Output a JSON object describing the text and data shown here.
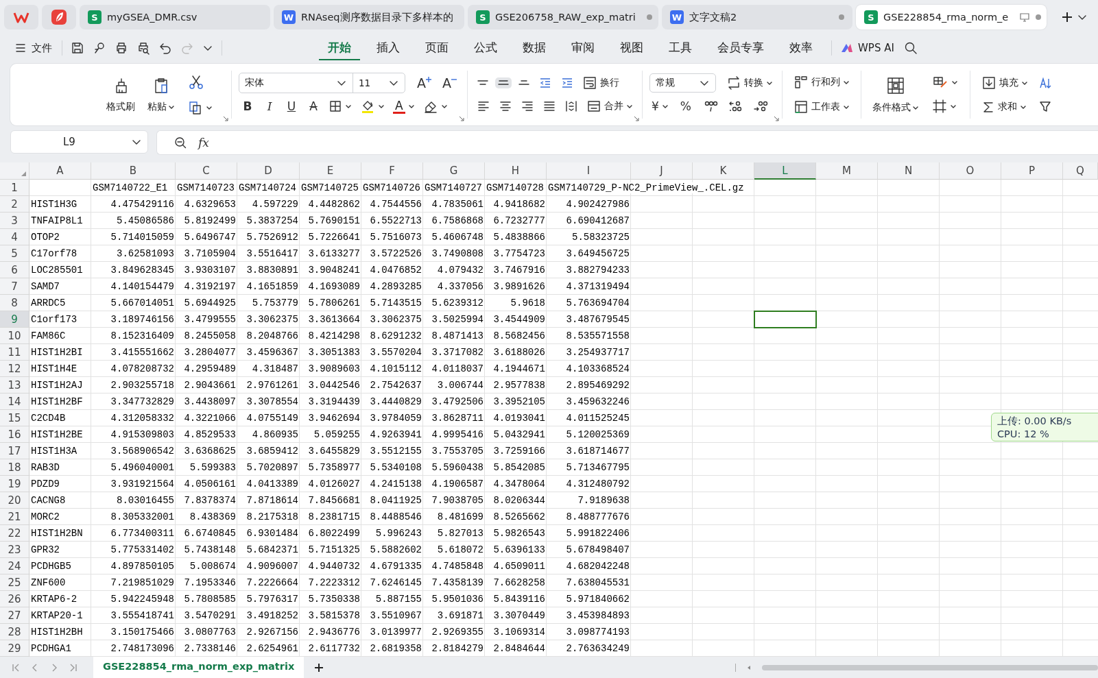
{
  "title_tabs": [
    {
      "kind": "sheet",
      "badge": "S",
      "label": "myGSEA_DMR.csv",
      "selected": false,
      "unsaved": false,
      "monitor": false
    },
    {
      "kind": "writer",
      "badge": "W",
      "label": "RNAseq测序数据目录下多样本的",
      "selected": false,
      "unsaved": false,
      "monitor": false
    },
    {
      "kind": "sheet",
      "badge": "S",
      "label": "GSE206758_RAW_exp_matri",
      "selected": false,
      "unsaved": true,
      "monitor": false
    },
    {
      "kind": "writer",
      "badge": "W",
      "label": "文字文稿2",
      "selected": false,
      "unsaved": true,
      "monitor": false
    },
    {
      "kind": "sheet",
      "badge": "S",
      "label": "GSE228854_rma_norm_e",
      "selected": true,
      "unsaved": true,
      "monitor": true
    }
  ],
  "menu": {
    "file": "文件",
    "quick_access": [
      {
        "kind": "save",
        "disabled": false
      },
      {
        "kind": "loop",
        "disabled": false
      },
      {
        "kind": "print",
        "disabled": false
      },
      {
        "kind": "preview",
        "disabled": false
      },
      {
        "kind": "undo",
        "disabled": false
      },
      {
        "kind": "redo",
        "disabled": true
      },
      {
        "kind": "more",
        "disabled": false
      }
    ],
    "tabs": [
      {
        "label": "开始",
        "selected": true
      },
      {
        "label": "插入",
        "selected": false
      },
      {
        "label": "页面",
        "selected": false
      },
      {
        "label": "公式",
        "selected": false
      },
      {
        "label": "数据",
        "selected": false
      },
      {
        "label": "审阅",
        "selected": false
      },
      {
        "label": "视图",
        "selected": false
      },
      {
        "label": "工具",
        "selected": false
      },
      {
        "label": "会员专享",
        "selected": false
      },
      {
        "label": "效率",
        "selected": false
      }
    ],
    "ai": "WPS AI"
  },
  "ribbon": {
    "format_painter": "格式刷",
    "paste": "粘贴",
    "font": "宋体",
    "font_size": "11",
    "size_buttons": [
      {
        "kind": "grow",
        "label": "A"
      },
      {
        "kind": "shrink",
        "label": "A"
      }
    ],
    "style_buttons": [
      {
        "kind": "bold",
        "label": "B"
      },
      {
        "kind": "italic",
        "label": "I"
      },
      {
        "kind": "underline",
        "label": "U"
      },
      {
        "kind": "strike",
        "label": "A"
      }
    ],
    "font_color": "A",
    "valign": [
      {
        "selected": false
      },
      {
        "selected": true
      },
      {
        "selected": false
      }
    ],
    "wrap": "换行",
    "merge": "合并",
    "number_format": "常规",
    "convert": "转换",
    "currency": "¥",
    "percent": "%",
    "rows_cols": "行和列",
    "worksheet": "工作表",
    "cond_format": "条件格式",
    "fill": "填充",
    "sum": "求和"
  },
  "formula_bar": {
    "name_box": "L9",
    "function_label": "fx"
  },
  "sheet": {
    "columns": [
      {
        "label": "A",
        "selected": false
      },
      {
        "label": "B",
        "selected": false
      },
      {
        "label": "C",
        "selected": false
      },
      {
        "label": "D",
        "selected": false
      },
      {
        "label": "E",
        "selected": false
      },
      {
        "label": "F",
        "selected": false
      },
      {
        "label": "G",
        "selected": false
      },
      {
        "label": "H",
        "selected": false
      },
      {
        "label": "I",
        "selected": false
      },
      {
        "label": "J",
        "selected": false
      },
      {
        "label": "K",
        "selected": false
      },
      {
        "label": "L",
        "selected": true
      },
      {
        "label": "M",
        "selected": false
      },
      {
        "label": "N",
        "selected": false
      },
      {
        "label": "O",
        "selected": false
      },
      {
        "label": "P",
        "selected": false
      },
      {
        "label": "Q",
        "selected": false
      }
    ],
    "header_row": {
      "number": "1",
      "selected": false,
      "cells": [
        "GSM7140722_E1",
        "GSM7140723",
        "GSM7140724",
        "GSM7140725",
        "GSM7140726",
        "GSM7140727",
        "GSM7140728",
        "GSM7140729_P-NC2_PrimeView_.CEL.gz"
      ]
    },
    "rows": [
      {
        "number": "2",
        "selected": false,
        "cells": [
          "HIST1H3G",
          "4.475429116",
          "4.6329653",
          "4.597229",
          "4.4482862",
          "4.7544556",
          "4.7835061",
          "4.9418682",
          "4.902427986"
        ]
      },
      {
        "number": "3",
        "selected": false,
        "cells": [
          "TNFAIP8L1",
          "5.45086586",
          "5.8192499",
          "5.3837254",
          "5.7690151",
          "6.5522713",
          "6.7586868",
          "6.7232777",
          "6.690412687"
        ]
      },
      {
        "number": "4",
        "selected": false,
        "cells": [
          "OTOP2",
          "5.714015059",
          "5.6496747",
          "5.7526912",
          "5.7226641",
          "5.7516073",
          "5.4606748",
          "5.4838866",
          "5.58323725"
        ]
      },
      {
        "number": "5",
        "selected": false,
        "cells": [
          "C17orf78",
          "3.62581093",
          "3.7105904",
          "3.5516417",
          "3.6133277",
          "3.5722526",
          "3.7490808",
          "3.7754723",
          "3.649456725"
        ]
      },
      {
        "number": "6",
        "selected": false,
        "cells": [
          "LOC285501",
          "3.849628345",
          "3.9303107",
          "3.8830891",
          "3.9048241",
          "4.0476852",
          "4.079432",
          "3.7467916",
          "3.882794233"
        ]
      },
      {
        "number": "7",
        "selected": false,
        "cells": [
          "SAMD7",
          "4.140154479",
          "4.3192197",
          "4.1651859",
          "4.1693089",
          "4.2893285",
          "4.337056",
          "3.9891626",
          "4.371319494"
        ]
      },
      {
        "number": "8",
        "selected": false,
        "cells": [
          "ARRDC5",
          "5.667014051",
          "5.6944925",
          "5.753779",
          "5.7806261",
          "5.7143515",
          "5.6239312",
          "5.9618",
          "5.763694704"
        ]
      },
      {
        "number": "9",
        "selected": true,
        "cells": [
          "C1orf173",
          "3.189746156",
          "3.4799555",
          "3.3062375",
          "3.3613664",
          "3.3062375",
          "3.5025994",
          "3.4544909",
          "3.487679545"
        ]
      },
      {
        "number": "10",
        "selected": false,
        "cells": [
          "FAM86C",
          "8.152316409",
          "8.2455058",
          "8.2048766",
          "8.4214298",
          "8.6291232",
          "8.4871413",
          "8.5682456",
          "8.535571558"
        ]
      },
      {
        "number": "11",
        "selected": false,
        "cells": [
          "HIST1H2BI",
          "3.415551662",
          "3.2804077",
          "3.4596367",
          "3.3051383",
          "3.5570204",
          "3.3717082",
          "3.6188026",
          "3.254937717"
        ]
      },
      {
        "number": "12",
        "selected": false,
        "cells": [
          "HIST1H4E",
          "4.078208732",
          "4.2959489",
          "4.318487",
          "3.9089603",
          "4.1015112",
          "4.0118037",
          "4.1944671",
          "4.103368524"
        ]
      },
      {
        "number": "13",
        "selected": false,
        "cells": [
          "HIST1H2AJ",
          "2.903255718",
          "2.9043661",
          "2.9761261",
          "3.0442546",
          "2.7542637",
          "3.006744",
          "2.9577838",
          "2.895469292"
        ]
      },
      {
        "number": "14",
        "selected": false,
        "cells": [
          "HIST1H2BF",
          "3.347732829",
          "3.4438097",
          "3.3078554",
          "3.3194439",
          "3.4440829",
          "3.4792506",
          "3.3952105",
          "3.459632246"
        ]
      },
      {
        "number": "15",
        "selected": false,
        "cells": [
          "C2CD4B",
          "4.312058332",
          "4.3221066",
          "4.0755149",
          "3.9462694",
          "3.9784059",
          "3.8628711",
          "4.0193041",
          "4.011525245"
        ]
      },
      {
        "number": "16",
        "selected": false,
        "cells": [
          "HIST1H2BE",
          "4.915309803",
          "4.8529533",
          "4.860935",
          "5.059255",
          "4.9263941",
          "4.9995416",
          "5.0432941",
          "5.120025369"
        ]
      },
      {
        "number": "17",
        "selected": false,
        "cells": [
          "HIST1H3A",
          "3.568906542",
          "3.6368625",
          "3.6859412",
          "3.6455829",
          "3.5512155",
          "3.7553705",
          "3.7259166",
          "3.618714677"
        ]
      },
      {
        "number": "18",
        "selected": false,
        "cells": [
          "RAB3D",
          "5.496040001",
          "5.599383",
          "5.7020897",
          "5.7358977",
          "5.5340108",
          "5.5960438",
          "5.8542085",
          "5.713467795"
        ]
      },
      {
        "number": "19",
        "selected": false,
        "cells": [
          "PDZD9",
          "3.931921564",
          "4.0506161",
          "4.0413389",
          "4.0126027",
          "4.2415138",
          "4.1906587",
          "4.3478064",
          "4.312480792"
        ]
      },
      {
        "number": "20",
        "selected": false,
        "cells": [
          "CACNG8",
          "8.03016455",
          "7.8378374",
          "7.8718614",
          "7.8456681",
          "8.0411925",
          "7.9038705",
          "8.0206344",
          "7.9189638"
        ]
      },
      {
        "number": "21",
        "selected": false,
        "cells": [
          "MORC2",
          "8.305332001",
          "8.438369",
          "8.2175318",
          "8.2381715",
          "8.4488546",
          "8.481699",
          "8.5265662",
          "8.488777676"
        ]
      },
      {
        "number": "22",
        "selected": false,
        "cells": [
          "HIST1H2BN",
          "6.773400311",
          "6.6740845",
          "6.9301484",
          "6.8022499",
          "5.996243",
          "5.827013",
          "5.9826543",
          "5.991822406"
        ]
      },
      {
        "number": "23",
        "selected": false,
        "cells": [
          "GPR32",
          "5.775331402",
          "5.7438148",
          "5.6842371",
          "5.7151325",
          "5.5882602",
          "5.618072",
          "5.6396133",
          "5.678498407"
        ]
      },
      {
        "number": "24",
        "selected": false,
        "cells": [
          "PCDHGB5",
          "4.897850105",
          "5.008674",
          "4.9096007",
          "4.9440732",
          "4.6791335",
          "4.7485848",
          "4.6509011",
          "4.682042248"
        ]
      },
      {
        "number": "25",
        "selected": false,
        "cells": [
          "ZNF600",
          "7.219851029",
          "7.1953346",
          "7.2226664",
          "7.2223312",
          "7.6246145",
          "7.4358139",
          "7.6628258",
          "7.638045531"
        ]
      },
      {
        "number": "26",
        "selected": false,
        "cells": [
          "KRTAP6-2",
          "5.942245948",
          "5.7808585",
          "5.7976317",
          "5.7350338",
          "5.887155",
          "5.9501036",
          "5.8439116",
          "5.971840662"
        ]
      },
      {
        "number": "27",
        "selected": false,
        "cells": [
          "KRTAP20-1",
          "3.555418741",
          "3.5470291",
          "3.4918252",
          "3.5815378",
          "3.5510967",
          "3.691871",
          "3.3070449",
          "3.453984893"
        ]
      },
      {
        "number": "28",
        "selected": false,
        "cells": [
          "HIST1H2BH",
          "3.150175466",
          "3.0807763",
          "2.9267156",
          "2.9436776",
          "3.0139977",
          "2.9269355",
          "3.1069314",
          "3.098774193"
        ]
      },
      {
        "number": "29",
        "selected": false,
        "cells": [
          "PCDHGA1",
          "2.748173096",
          "2.7338146",
          "2.6254961",
          "2.6117732",
          "2.6819358",
          "2.8184279",
          "2.8484644",
          "2.763634249"
        ]
      }
    ]
  },
  "sheet_tabs": [
    {
      "label": "GSE228854_rma_norm_exp_matrix",
      "selected": true
    }
  ],
  "net_monitor": {
    "upload": "上传: 0.00 KB/s",
    "cpu": "CPU: 12 %"
  }
}
